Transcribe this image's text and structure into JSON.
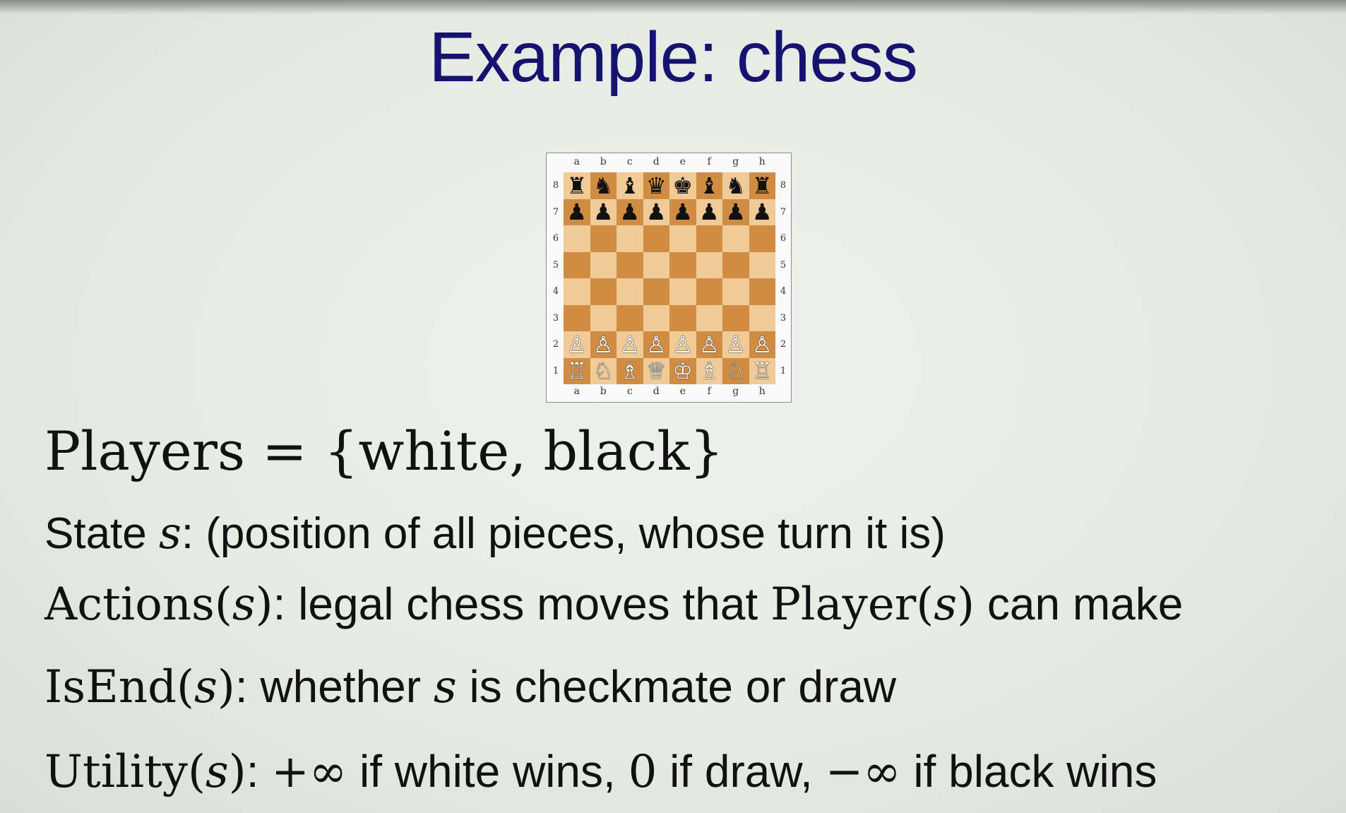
{
  "slide": {
    "title": "Example: chess"
  },
  "board": {
    "files": [
      "a",
      "b",
      "c",
      "d",
      "e",
      "f",
      "g",
      "h"
    ],
    "ranks": [
      "8",
      "7",
      "6",
      "5",
      "4",
      "3",
      "2",
      "1"
    ],
    "rows": [
      [
        "♜",
        "♞",
        "♝",
        "♛",
        "♚",
        "♝",
        "♞",
        "♜"
      ],
      [
        "♟",
        "♟",
        "♟",
        "♟",
        "♟",
        "♟",
        "♟",
        "♟"
      ],
      [
        "",
        "",
        "",
        "",
        "",
        "",
        "",
        ""
      ],
      [
        "",
        "",
        "",
        "",
        "",
        "",
        "",
        ""
      ],
      [
        "",
        "",
        "",
        "",
        "",
        "",
        "",
        ""
      ],
      [
        "",
        "",
        "",
        "",
        "",
        "",
        "",
        ""
      ],
      [
        "♙",
        "♙",
        "♙",
        "♙",
        "♙",
        "♙",
        "♙",
        "♙"
      ],
      [
        "♖",
        "♘",
        "♗",
        "♕",
        "♔",
        "♗",
        "♘",
        "♖"
      ]
    ],
    "light_color": "#f0ca97",
    "dark_color": "#d18c43"
  },
  "lines": {
    "players": {
      "label": "Players",
      "eq": " = ",
      "set": "{white, black}"
    },
    "state": {
      "label": "State ",
      "var": "s",
      "rest": ": (position of all pieces, whose turn it is)"
    },
    "actions": {
      "fn": "Actions",
      "open": "(",
      "var": "s",
      "close": ")",
      "rest": ": legal chess moves that ",
      "fn2": "Player",
      "open2": "(",
      "var2": "s",
      "close2": ")",
      "rest2": " can make"
    },
    "isend": {
      "fn": "IsEnd",
      "open": "(",
      "var": "s",
      "close": ")",
      "rest": ": whether ",
      "var2": "s",
      "rest2": " is checkmate or draw"
    },
    "utility": {
      "fn": "Utility",
      "open": "(",
      "var": "s",
      "close": ")",
      "colon": ": ",
      "pos_inf": "+∞",
      "t1": " if white wins, ",
      "zero": "0",
      "t2": " if draw, ",
      "neg_inf": "−∞",
      "t3": " if black wins"
    }
  }
}
